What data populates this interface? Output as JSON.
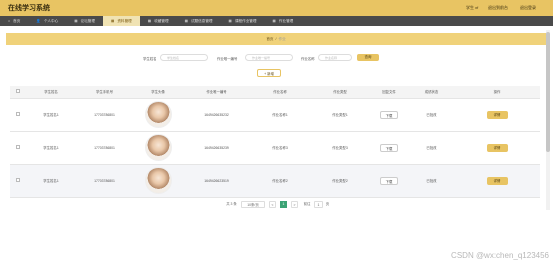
{
  "app": {
    "title": "在线学习系统"
  },
  "user": {
    "role": "学生 xf",
    "back": "退出到前台",
    "logout": "退出登录"
  },
  "nav": [
    {
      "icon": "home-icon",
      "glyph": "⌂",
      "label": "首页",
      "active": false
    },
    {
      "icon": "user-icon",
      "glyph": "👤",
      "label": "个人中心",
      "active": false
    },
    {
      "icon": "grid-icon",
      "glyph": "▦",
      "label": "论坛管理",
      "active": false
    },
    {
      "icon": "grid-icon",
      "glyph": "▦",
      "label": "资料管理",
      "active": true
    },
    {
      "icon": "grid-icon",
      "glyph": "▦",
      "label": "收藏管理",
      "active": false
    },
    {
      "icon": "grid-icon",
      "glyph": "▦",
      "label": "试题信息管理",
      "active": false
    },
    {
      "icon": "grid-icon",
      "glyph": "▦",
      "label": "课程作业管理",
      "active": false
    },
    {
      "icon": "grid-icon",
      "glyph": "▦",
      "label": "作业管理",
      "active": false
    }
  ],
  "breadcrumb": {
    "home": "首页",
    "sep": "/",
    "current": "作业"
  },
  "search": {
    "label1": "学生姓名",
    "ph1": "学生姓名",
    "label2": "作业唯一编号",
    "ph2": "作业唯一编号",
    "label3": "作业名称",
    "ph3": "作业名称",
    "button": "查询"
  },
  "add_button": "+ 新增",
  "table": {
    "headers": [
      "学生姓名",
      "学生手机号",
      "学生头像",
      "作业唯一编号",
      "作业名称",
      "作业类型",
      "回复文件",
      "成绩状态",
      "操作"
    ],
    "rows": [
      {
        "name": "学生姓名1",
        "phone": "17703786801",
        "code": "1649426635232",
        "hw": "作业名称1",
        "type": "作业类型1",
        "file": "下载",
        "status": "已批改",
        "action": "详情"
      },
      {
        "name": "学生姓名1",
        "phone": "17703786801",
        "code": "1649426635239",
        "hw": "作业名称3",
        "type": "作业类型3",
        "file": "下载",
        "status": "已批改",
        "action": "详情"
      },
      {
        "name": "学生姓名1",
        "phone": "17703786801",
        "code": "1649426623519",
        "hw": "作业名称2",
        "type": "作业类型2",
        "file": "下载",
        "status": "已批改",
        "action": "详情"
      }
    ]
  },
  "pager": {
    "total": "共 3 条",
    "per_page": "10条/页",
    "prev": "<",
    "page": "1",
    "next": ">",
    "goto": "前往",
    "goto_value": "1",
    "page_unit": "页"
  },
  "watermark": "CSDN @wx:chen_q123456"
}
